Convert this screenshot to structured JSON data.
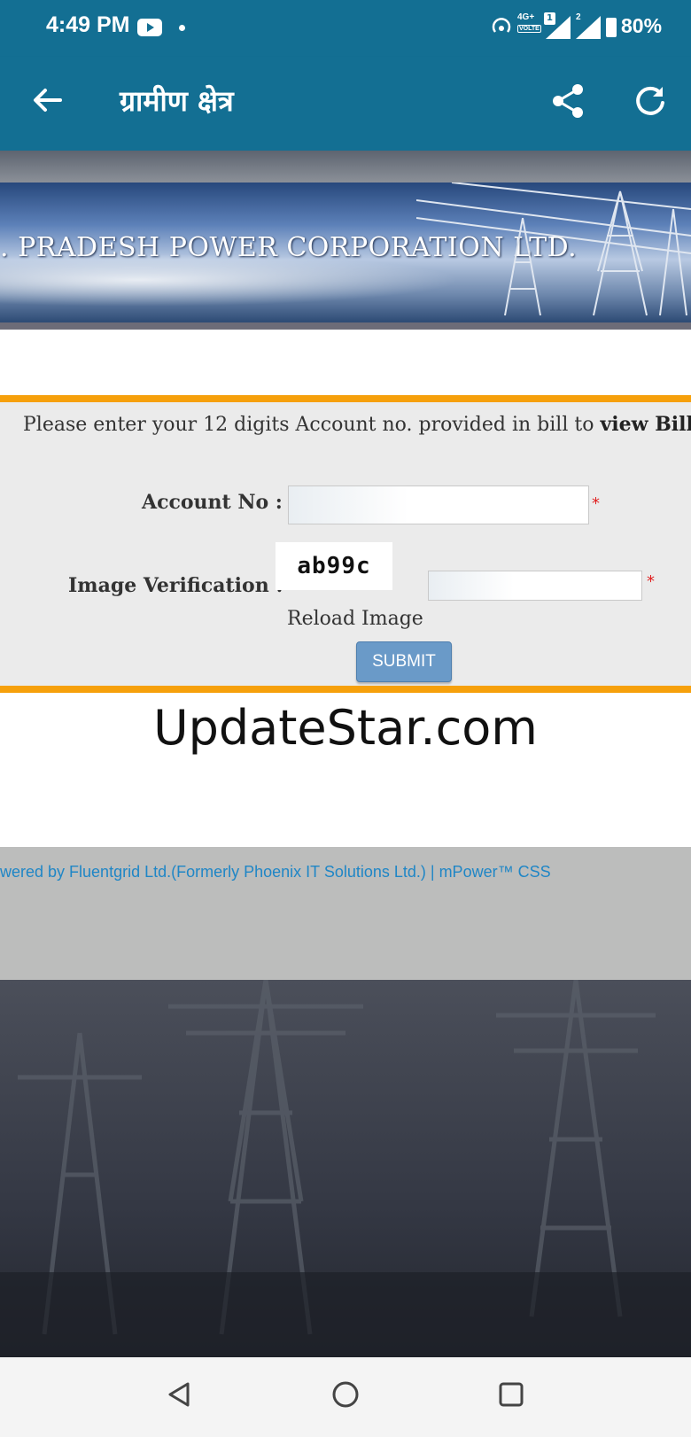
{
  "status_bar": {
    "time": "4:49 PM",
    "network": "4G+",
    "volte": "VOLTE",
    "sim1": "1",
    "sim2": "2",
    "battery": "80%"
  },
  "app_bar": {
    "title": "ग्रामीण क्षेत्र"
  },
  "banner": {
    "text": ". PRADESH POWER CORPORATION LTD."
  },
  "form": {
    "intro_prefix": "Please enter your 12 digits Account no. provided in bill to ",
    "intro_bold": "view Bill &",
    "account_label": "Account No :",
    "account_value": "",
    "required_mark": "*",
    "image_label": "Image Verification :",
    "captcha_text": "ab99c",
    "captcha_value": "",
    "reload_label": "Reload Image",
    "submit_label": "SUBMIT"
  },
  "watermark": "UpdateStar.com",
  "footer": {
    "powered_text": "wered by Fluentgrid Ltd.(Formerly Phoenix IT Solutions Ltd.) | mPower™ CSS"
  },
  "colors": {
    "app_bar": "#136f93",
    "accent_orange": "#f6a00b",
    "submit_button": "#6a9ac8",
    "footer_link": "#1f86c6"
  }
}
